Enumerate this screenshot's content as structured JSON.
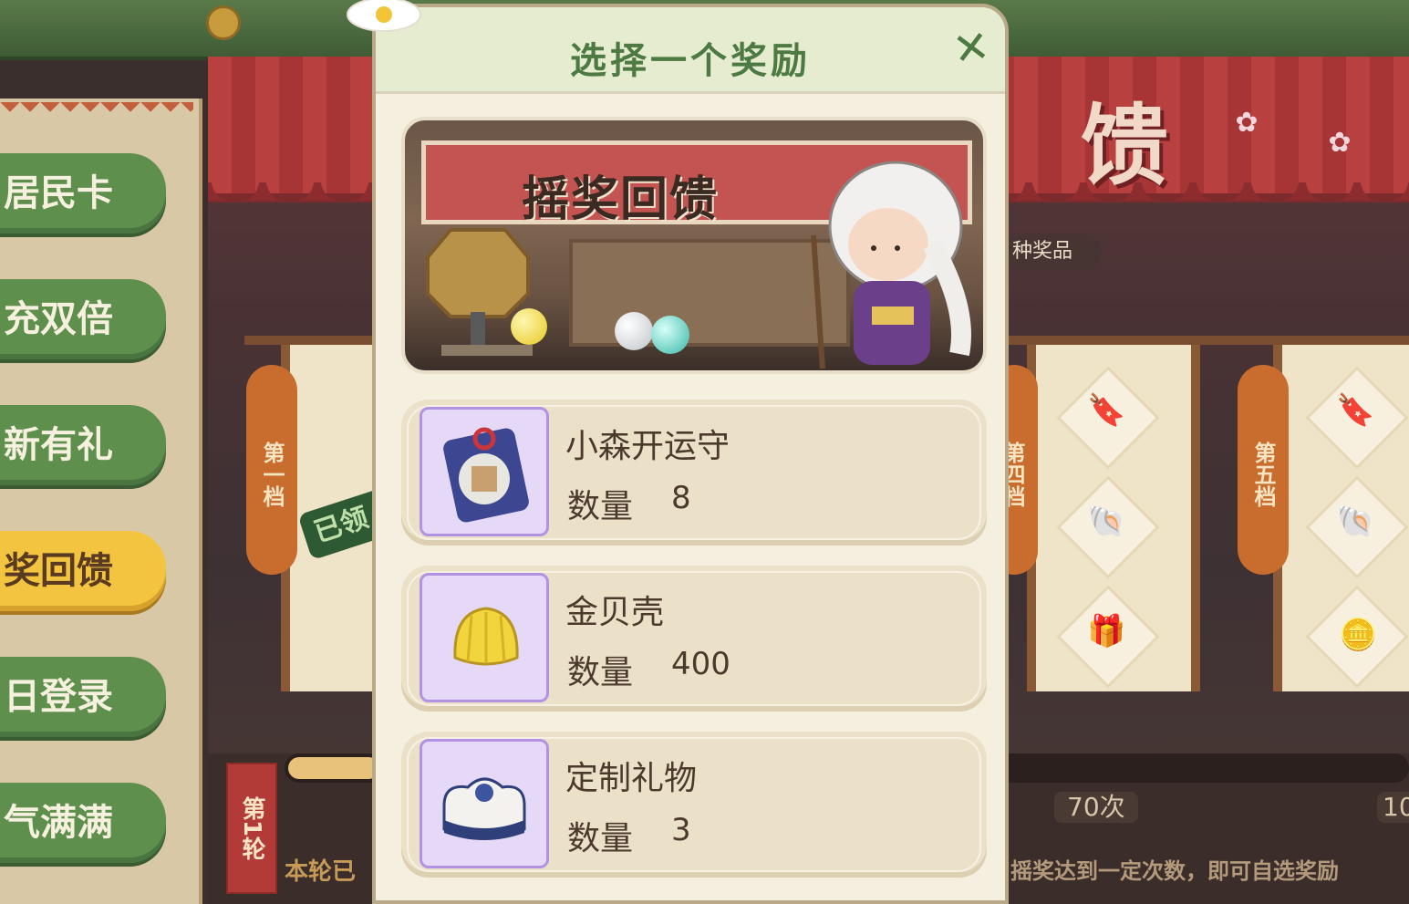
{
  "sidebar": {
    "items": [
      {
        "label": "居民卡",
        "active": false
      },
      {
        "label": "充双倍",
        "active": false
      },
      {
        "label": "新有礼",
        "active": false
      },
      {
        "label": "奖回馈",
        "active": true
      },
      {
        "label": "日登录",
        "active": false
      },
      {
        "label": "气满满",
        "active": false
      }
    ]
  },
  "background": {
    "big_char": "馈",
    "prize_pill": "种奖品",
    "tiers": [
      "第一档",
      "第四档",
      "第五档"
    ],
    "claimed_stamp": "已领",
    "round_tag": "第1轮",
    "round_text": "本轮已",
    "milestones": [
      "70次",
      "10"
    ],
    "hint": "摇奖达到一定次数，即可自选奖励"
  },
  "modal": {
    "title": "选择一个奖励",
    "close_icon": "close-x-icon",
    "banner_title": "摇奖回馈",
    "rewards": [
      {
        "name": "小森开运守",
        "qty_label": "数量",
        "qty": "8",
        "icon": "charm-icon"
      },
      {
        "name": "金贝壳",
        "qty_label": "数量",
        "qty": "400",
        "icon": "golden-shell-icon"
      },
      {
        "name": "定制礼物",
        "qty_label": "数量",
        "qty": "3",
        "icon": "gift-box-icon"
      }
    ]
  },
  "colors": {
    "accent_green": "#4d7a42",
    "nav_green": "#5f8f4d",
    "nav_active": "#f2c440",
    "icon_box": "#e5d9f7"
  }
}
